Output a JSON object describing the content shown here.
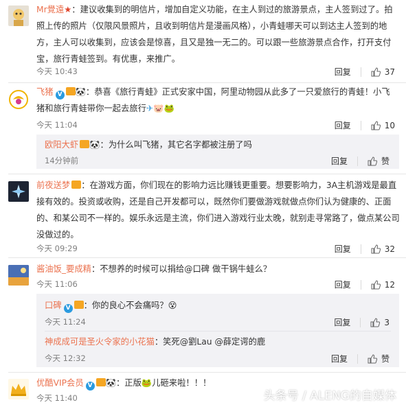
{
  "comments": [
    {
      "user": "Mr覺遠",
      "lines": [
        "：建议收集到的明信片，增加自定义功能，在主人到过的旅游景点，主人签到过了。拍",
        "照上传的照片（仅限风景照片，且收到明信片是漫画风格），小青蛙哪天可以到达主人签到的地",
        "方，主人可以收集到，应该会是惊喜，且又是独一无二的。可以跟一些旅游景点合作，打开支付",
        "宝，旅行青蛙签到。有优惠，来推广。"
      ],
      "time": "今天 10:43",
      "reply": "回复",
      "likes": "37"
    },
    {
      "user": "飞猪",
      "lines": [
        "：恭喜《旅行青蛙》正式安家中国，阿里动物园从此多了一只爱旅行的青蛙！小飞",
        "猪和旅行青蛙带你一起去旅行"
      ],
      "time": "今天 11:04",
      "reply": "回复",
      "likes": "10"
    },
    {
      "user": "欧阳大虾",
      "text": "：为什么叫飞猪，其它名字都被注册了吗",
      "time": "14分钟前",
      "reply": "回复",
      "like_label": "赞"
    },
    {
      "user": "前夜送梦",
      "lines": [
        "：在游戏方面，你们现在的影响力远比赚钱更重要。想要影响力，3A主机游戏是最直",
        "接有效的。投资或收购，还是自己开发都可以，既然你们要做游戏就做点你们认为健康的、正面",
        "的、和某公司不一样的。娱乐永远是主流，你们进入游戏行业太晚，就别走寻常路了，做点某公司",
        "没做过的。"
      ],
      "time": "今天 09:29",
      "reply": "回复",
      "likes": "32"
    },
    {
      "user": "酱油饭_要成精",
      "text": "：不想养的时候可以捐给@口碑  做干锅牛蛙么？",
      "time": "今天 11:06",
      "reply": "回复",
      "likes": "12"
    },
    {
      "user": "口碑",
      "text": "：你的良心不会痛吗？",
      "time": "今天 11:24",
      "reply": "回复",
      "likes": "3"
    },
    {
      "user": "神成成可是圣火令家的小花猫",
      "text": "：笑死@劉Lau @薛定谔的鹿",
      "time": "今天 12:32",
      "reply": "回复",
      "like_label": "赞"
    },
    {
      "user": "优酷VIP会员",
      "text_a": "：正版",
      "text_b": "儿砸来啦！！！",
      "time": "今天 11:40"
    }
  ],
  "watermark": "头条号 / ALENG的自媒体",
  "colors": {
    "username": "#eb7350",
    "time": "#808080",
    "reply_bg": "#f2f2f5"
  }
}
